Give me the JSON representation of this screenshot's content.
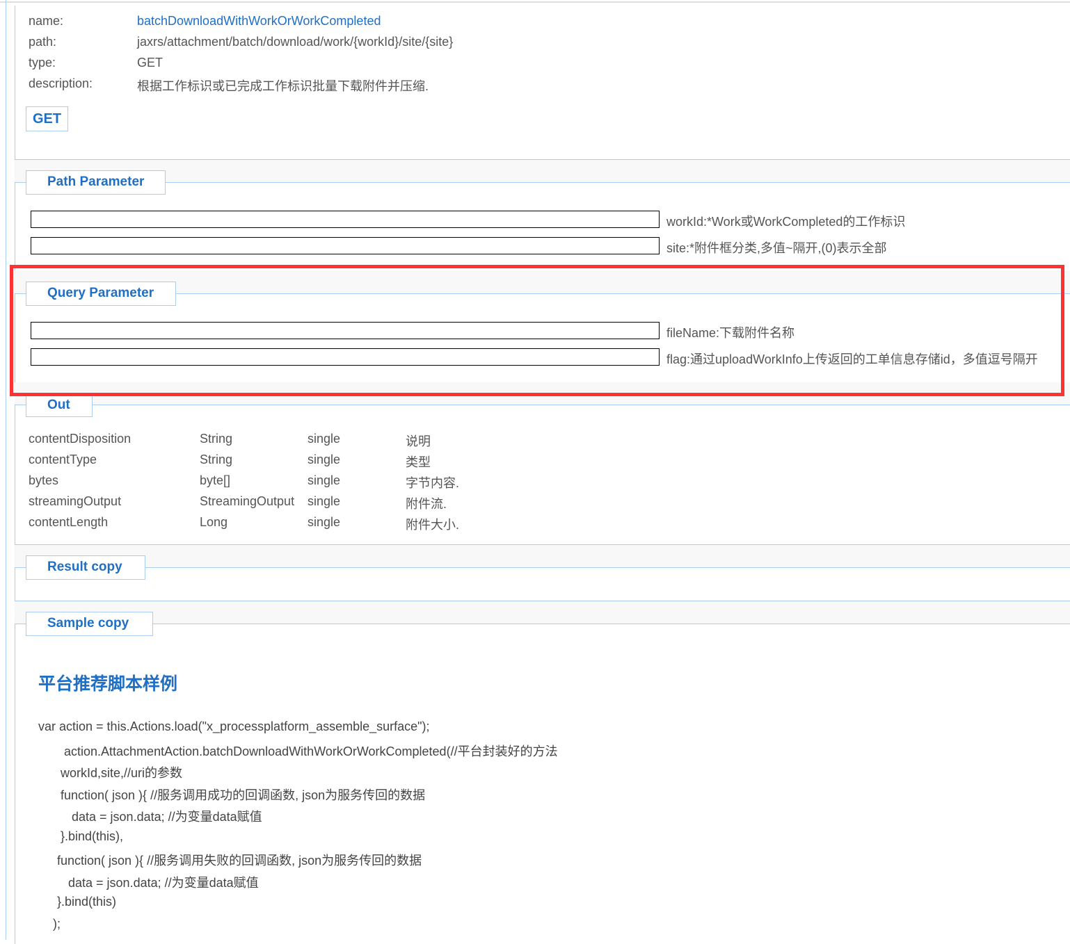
{
  "info": {
    "name_label": "name:",
    "name": "batchDownloadWithWorkOrWorkCompleted",
    "path_label": "path:",
    "path": "jaxrs/attachment/batch/download/work/{workId}/site/{site}",
    "type_label": "type:",
    "type": "GET",
    "description_label": "description:",
    "description": "根据工作标识或已完成工作标识批量下载附件并压缩.",
    "get_button": "GET"
  },
  "path_parameter": {
    "title": "Path Parameter",
    "params": [
      {
        "label": "workId:*Work或WorkCompleted的工作标识",
        "value": ""
      },
      {
        "label": "site:*附件框分类,多值~隔开,(0)表示全部",
        "value": ""
      }
    ]
  },
  "query_parameter": {
    "title": "Query Parameter",
    "params": [
      {
        "label": "fileName:下载附件名称",
        "value": ""
      },
      {
        "label": "flag:通过uploadWorkInfo上传返回的工单信息存储id，多值逗号隔开",
        "value": ""
      }
    ]
  },
  "out": {
    "title": "Out",
    "rows": [
      [
        "contentDisposition",
        "String",
        "single",
        "说明"
      ],
      [
        "contentType",
        "String",
        "single",
        "类型"
      ],
      [
        "bytes",
        "byte[]",
        "single",
        "字节内容."
      ],
      [
        "streamingOutput",
        "StreamingOutput",
        "single",
        "附件流."
      ],
      [
        "contentLength",
        "Long",
        "single",
        "附件大小."
      ]
    ]
  },
  "result": {
    "title": "Result copy"
  },
  "sample": {
    "title": "Sample copy",
    "heading": "平台推荐脚本样例",
    "code": [
      "var action = this.Actions.load(\"x_processplatform_assemble_surface\");",
      "action.AttachmentAction.batchDownloadWithWorkOrWorkCompleted(//平台封装好的方法",
      "workId,site,//uri的参数",
      "function( json ){ //服务调用成功的回调函数, json为服务传回的数据",
      "data = json.data; //为变量data赋值",
      "}.bind(this),",
      "function( json ){ //服务调用失败的回调函数, json为服务传回的数据",
      "data = json.data; //为变量data赋值",
      "}.bind(this)",
      ");"
    ]
  },
  "colors": {
    "accent": "#1f6fc5",
    "highlight": "#ff3333",
    "border": "#a9cdf0"
  }
}
